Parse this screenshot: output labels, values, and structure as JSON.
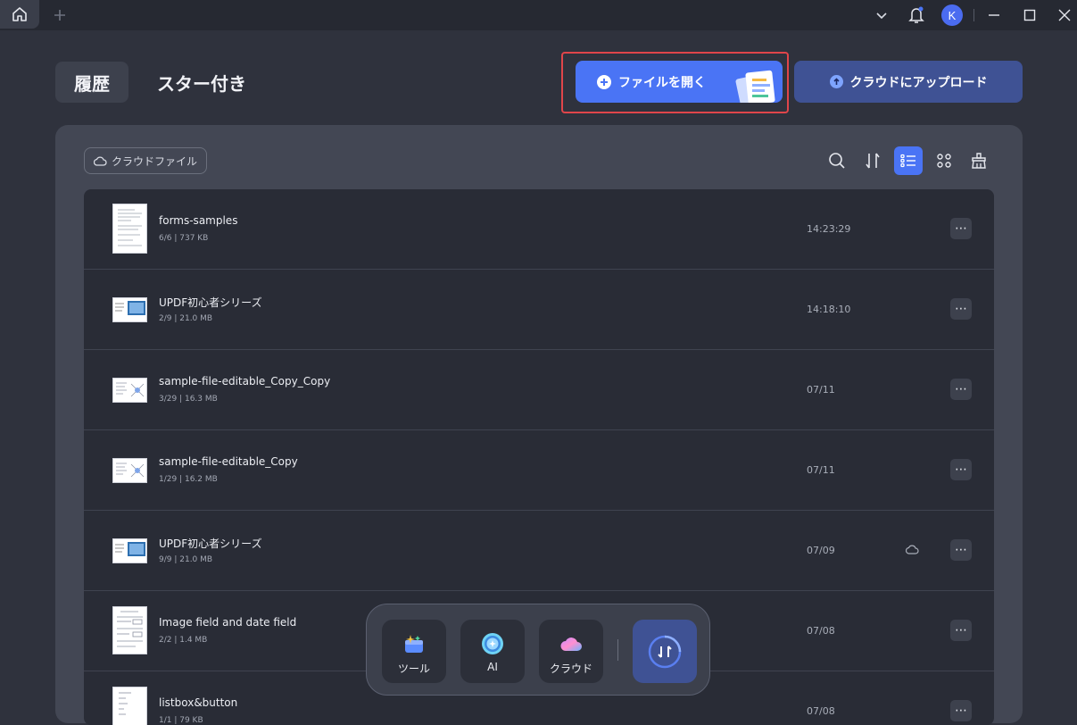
{
  "header": {
    "tabs": [
      {
        "label": "履歴",
        "active": true
      },
      {
        "label": "スター付き",
        "active": false
      }
    ],
    "open_file_label": "ファイルを開く",
    "upload_label": "クラウドにアップロード"
  },
  "titlebar": {
    "avatar_initial": "K"
  },
  "panel": {
    "cloud_filter_label": "クラウドファイル",
    "tools": [
      "search-icon",
      "sort-icon",
      "list-view-icon",
      "grid-view-icon",
      "clean-icon"
    ]
  },
  "files": [
    {
      "name": "forms-samples",
      "meta": "6/6 | 737 KB",
      "time": "14:23:29",
      "cloud": false
    },
    {
      "name": "UPDF初心者シリーズ",
      "meta": "2/9 | 21.0 MB",
      "time": "14:18:10",
      "cloud": false
    },
    {
      "name": "sample-file-editable_Copy_Copy",
      "meta": "3/29 | 16.3 MB",
      "time": "07/11",
      "cloud": false
    },
    {
      "name": "sample-file-editable_Copy",
      "meta": "1/29 | 16.2 MB",
      "time": "07/11",
      "cloud": false
    },
    {
      "name": "UPDF初心者シリーズ",
      "meta": "9/9 | 21.0 MB",
      "time": "07/09",
      "cloud": true
    },
    {
      "name": "Image field and date field",
      "meta": "2/2 | 1.4 MB",
      "time": "07/08",
      "cloud": false
    },
    {
      "name": "listbox&button",
      "meta": "1/1 | 79 KB",
      "time": "07/08",
      "cloud": false
    }
  ],
  "dock": {
    "tools_label": "ツール",
    "ai_label": "AI",
    "cloud_label": "クラウド"
  },
  "colors": {
    "accent": "#4a74f5",
    "highlight": "#e0454a",
    "background": "#2f323d"
  }
}
